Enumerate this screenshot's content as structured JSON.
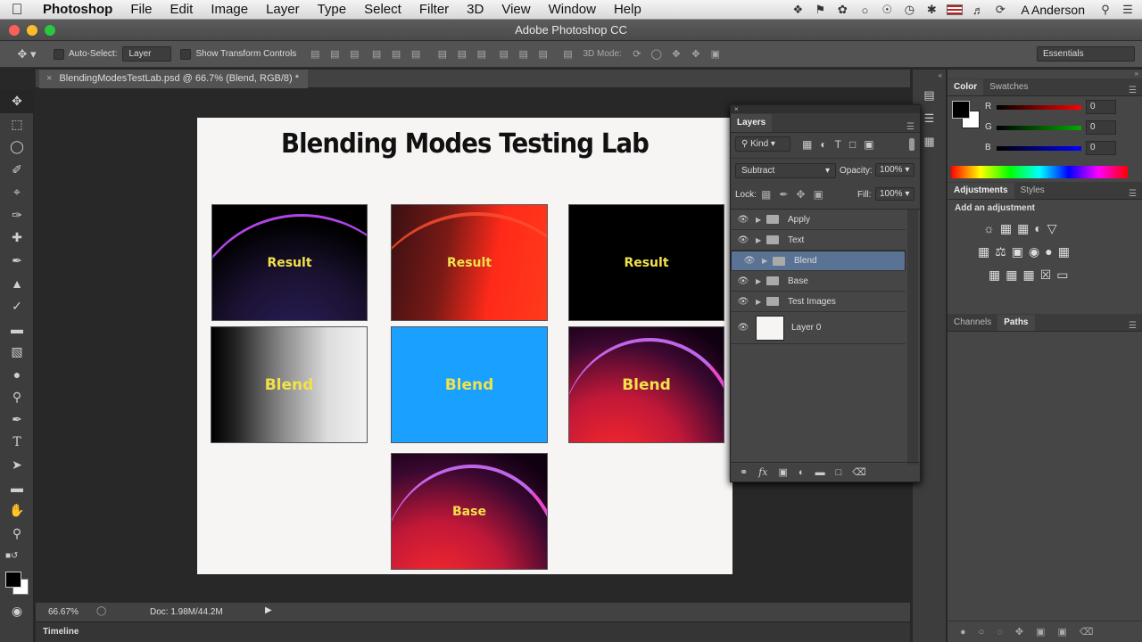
{
  "menubar": {
    "app": "Photoshop",
    "items": [
      "File",
      "Edit",
      "Image",
      "Layer",
      "Type",
      "Select",
      "Filter",
      "3D",
      "View",
      "Window",
      "Help"
    ],
    "user": "A Anderson"
  },
  "window": {
    "title": "Adobe Photoshop CC"
  },
  "options": {
    "auto_select": "Auto-Select:",
    "auto_select_value": "Layer",
    "show_transform": "Show Transform Controls",
    "mode3d": "3D Mode:",
    "workspace": "Essentials"
  },
  "document": {
    "tab": "BlendingModesTestLab.psd @ 66.7% (Blend, RGB/8) *",
    "title": "Blending Modes Testing Lab",
    "thumbs": {
      "r1c1": "Result",
      "r1c2": "Result",
      "r1c3": "Result",
      "r2c1": "Blend",
      "r2c2": "Blend",
      "r2c3": "Blend",
      "base": "Base"
    }
  },
  "status": {
    "zoom": "66.67%",
    "doc": "Doc: 1.98M/44.2M",
    "timeline": "Timeline"
  },
  "layers_panel": {
    "title": "Layers",
    "kind": "Kind",
    "blend_mode": "Subtract",
    "opacity_label": "Opacity:",
    "opacity": "100%",
    "lock_label": "Lock:",
    "fill_label": "Fill:",
    "fill": "100%",
    "layers": [
      "Apply",
      "Text",
      "Blend",
      "Base",
      "Test Images",
      "Layer 0"
    ]
  },
  "color_panel": {
    "tabs": [
      "Color",
      "Swatches"
    ],
    "r_label": "R",
    "g_label": "G",
    "b_label": "B",
    "r": "0",
    "g": "0",
    "b": "0"
  },
  "adjust_panel": {
    "tabs": [
      "Adjustments",
      "Styles"
    ],
    "add": "Add an adjustment"
  },
  "paths_panel": {
    "tabs": [
      "Channels",
      "Paths"
    ]
  },
  "colors": {
    "selected_layer": "#5a7395",
    "blend_blue": "#1aa0ff",
    "label_yellow": "#f1e24a"
  }
}
